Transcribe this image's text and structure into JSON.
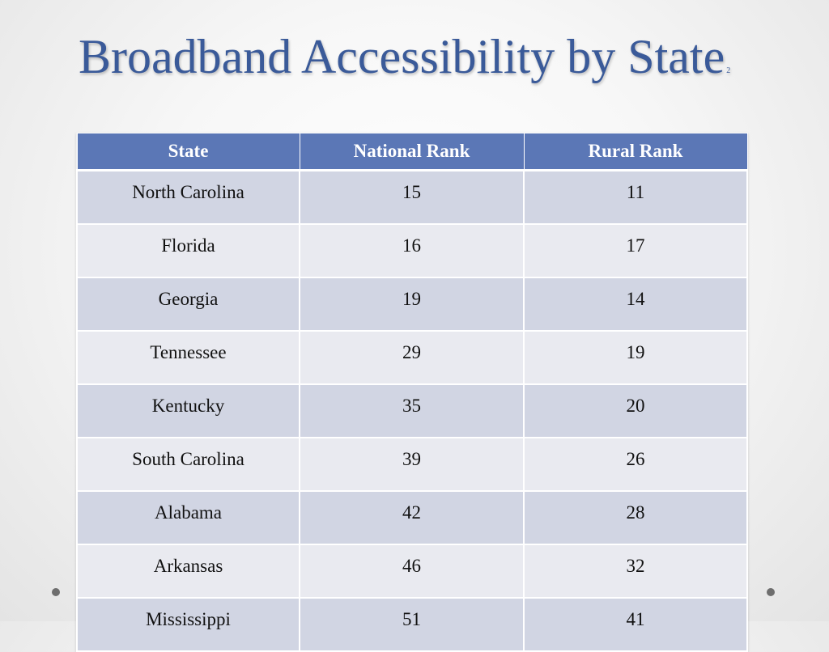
{
  "slide": {
    "title": "Broadband Accessibility by State",
    "title_footnote": "2"
  },
  "table": {
    "headers": [
      "State",
      "National Rank",
      "Rural Rank"
    ],
    "header_color": "#5b77b6",
    "rows": [
      {
        "state": "North Carolina",
        "national_rank": "15",
        "rural_rank": "11"
      },
      {
        "state": "Florida",
        "national_rank": "16",
        "rural_rank": "17"
      },
      {
        "state": "Georgia",
        "national_rank": "19",
        "rural_rank": "14"
      },
      {
        "state": "Tennessee",
        "national_rank": "29",
        "rural_rank": "19"
      },
      {
        "state": "Kentucky",
        "national_rank": "35",
        "rural_rank": "20"
      },
      {
        "state": "South Carolina",
        "national_rank": "39",
        "rural_rank": "26"
      },
      {
        "state": "Alabama",
        "national_rank": "42",
        "rural_rank": "28"
      },
      {
        "state": "Arkansas",
        "national_rank": "46",
        "rural_rank": "32"
      },
      {
        "state": "Mississippi",
        "national_rank": "51",
        "rural_rank": "41"
      }
    ]
  },
  "decorations": {
    "corner_dots": [
      "bottom-left-dot",
      "bottom-right-dot"
    ]
  }
}
